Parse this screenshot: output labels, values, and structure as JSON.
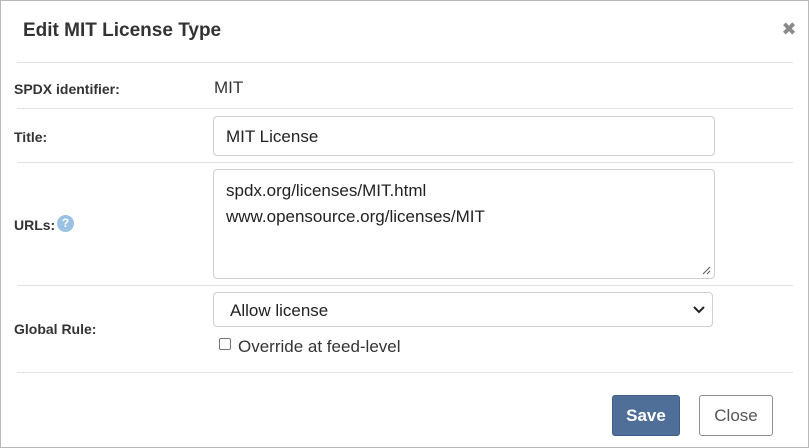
{
  "dialog": {
    "title": "Edit MIT License Type",
    "close_icon": "close-icon"
  },
  "fields": {
    "spdx": {
      "label": "SPDX identifier:",
      "value": "MIT"
    },
    "title": {
      "label": "Title:",
      "value": "MIT License"
    },
    "urls": {
      "label": "URLs:",
      "lines": [
        "spdx.org/licenses/MIT.html",
        "www.opensource.org/licenses/MIT"
      ],
      "help_icon": "help-icon"
    },
    "global_rule": {
      "label": "Global Rule:",
      "selected": "Allow license",
      "override_label": "Override at feed-level",
      "override_checked": false
    }
  },
  "buttons": {
    "save": "Save",
    "close": "Close"
  },
  "colors": {
    "primary": "#4f6f99",
    "help_icon": "#9bc1e3"
  }
}
